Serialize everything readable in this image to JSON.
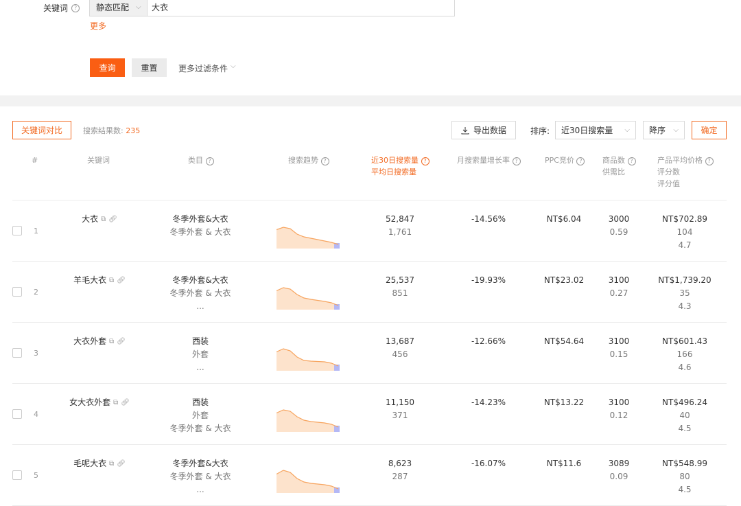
{
  "filter": {
    "keyword_label": "关键词",
    "help_glyph": "?",
    "match_mode": "静态匹配",
    "keyword_value": "大衣",
    "more_label": "更多",
    "query_label": "查询",
    "reset_label": "重置",
    "more_filters_label": "更多过滤条件"
  },
  "toolbar": {
    "compare_label": "关键词对比",
    "result_count_label": "搜索结果数:",
    "result_count": "235",
    "export_label": "导出数据",
    "sort_label": "排序:",
    "sort_value": "近30日搜索量",
    "order_value": "降序",
    "confirm_label": "确定"
  },
  "table": {
    "headers": {
      "index": "#",
      "keyword": "关键词",
      "category": "类目",
      "trend": "搜索趋势",
      "search_volume_1": "近30日搜索量",
      "search_volume_2": "平均日搜索量",
      "growth": "月搜索量增长率",
      "ppc": "PPC竞价",
      "products_1": "商品数",
      "products_2": "供需比",
      "price_1": "产品平均价格",
      "price_2": "评分数",
      "price_3": "评分值"
    },
    "rows": [
      {
        "index": "1",
        "keyword": "大衣",
        "cat1": "冬季外套&大衣",
        "cat2": "冬季外套 & 大衣",
        "cat3": "",
        "volume": "52,847",
        "daily": "1,761",
        "growth": "-14.56%",
        "ppc": "NT$6.04",
        "products": "3000",
        "ratio": "0.59",
        "price": "NT$702.89",
        "ratings": "104",
        "score": "4.7",
        "trend": [
          0.55,
          0.62,
          0.58,
          0.42,
          0.34,
          0.3,
          0.26,
          0.22,
          0.18,
          0.12
        ]
      },
      {
        "index": "2",
        "keyword": "羊毛大衣",
        "cat1": "冬季外套&大衣",
        "cat2": "冬季外套 & 大衣",
        "cat3": "...",
        "volume": "25,537",
        "daily": "851",
        "growth": "-19.93%",
        "ppc": "NT$23.02",
        "products": "3100",
        "ratio": "0.27",
        "price": "NT$1,739.20",
        "ratings": "35",
        "score": "4.3",
        "trend": [
          0.55,
          0.64,
          0.6,
          0.44,
          0.34,
          0.3,
          0.27,
          0.24,
          0.2,
          0.12
        ]
      },
      {
        "index": "3",
        "keyword": "大衣外套",
        "cat1": "西装",
        "cat2": "外套",
        "cat3": "...",
        "volume": "13,687",
        "daily": "456",
        "growth": "-12.66%",
        "ppc": "NT$54.64",
        "products": "3100",
        "ratio": "0.15",
        "price": "NT$601.43",
        "ratings": "166",
        "score": "4.6",
        "trend": [
          0.55,
          0.64,
          0.58,
          0.4,
          0.3,
          0.28,
          0.27,
          0.26,
          0.22,
          0.14
        ]
      },
      {
        "index": "4",
        "keyword": "女大衣外套",
        "cat1": "西装",
        "cat2": "外套",
        "cat3": "冬季外套 & 大衣",
        "volume": "11,150",
        "daily": "371",
        "growth": "-14.23%",
        "ppc": "NT$13.22",
        "products": "3100",
        "ratio": "0.12",
        "price": "NT$496.24",
        "ratings": "40",
        "score": "4.5",
        "trend": [
          0.55,
          0.64,
          0.6,
          0.44,
          0.34,
          0.3,
          0.28,
          0.26,
          0.22,
          0.14
        ]
      },
      {
        "index": "5",
        "keyword": "毛呢大衣",
        "cat1": "冬季外套&大衣",
        "cat2": "冬季外套 & 大衣",
        "cat3": "...",
        "volume": "8,623",
        "daily": "287",
        "growth": "-16.07%",
        "ppc": "NT$11.6",
        "products": "3089",
        "ratio": "0.09",
        "price": "NT$548.99",
        "ratings": "80",
        "score": "4.5",
        "trend": [
          0.55,
          0.66,
          0.6,
          0.42,
          0.32,
          0.28,
          0.26,
          0.24,
          0.2,
          0.12
        ]
      }
    ]
  },
  "colors": {
    "accent": "#f26a22",
    "query_button": "#fa5e13",
    "trend_line": "#f7a45e",
    "trend_fill": "#fde3cc",
    "trend_tail": "#b4b8f5"
  }
}
